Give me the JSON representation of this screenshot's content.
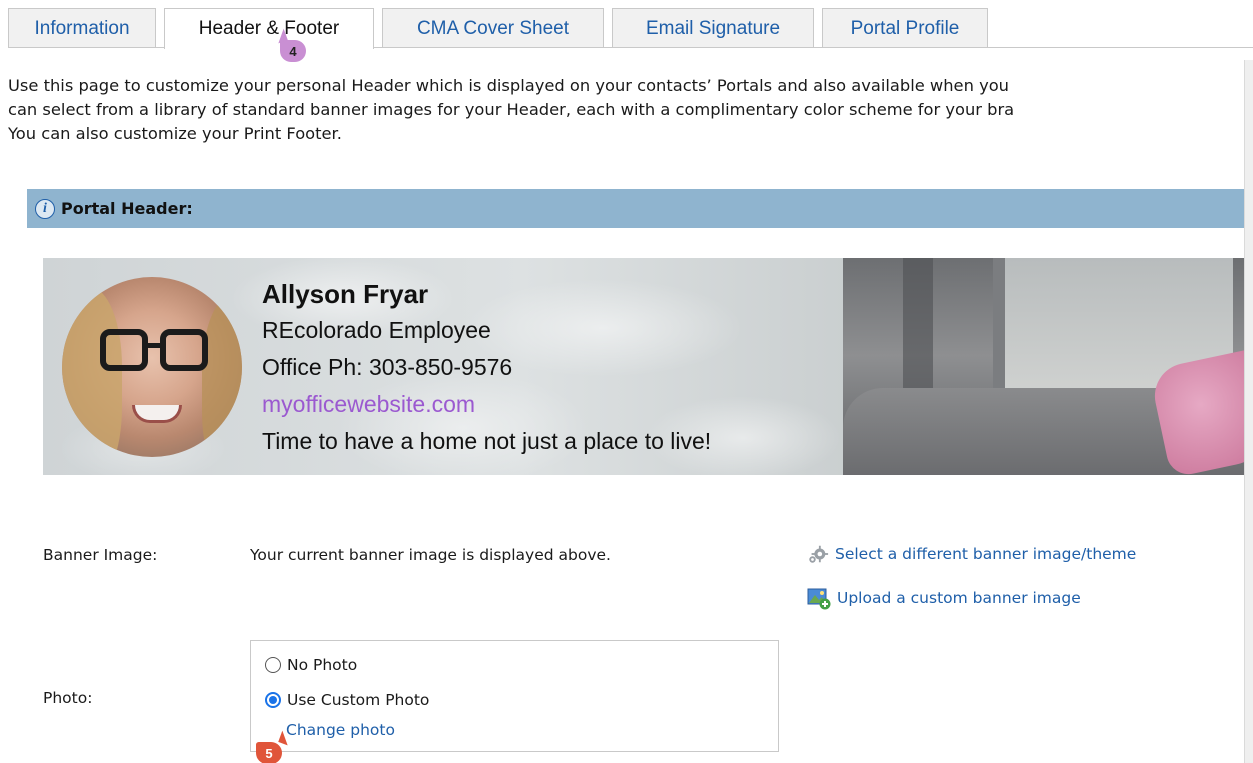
{
  "tabs": [
    {
      "label": "Information",
      "active": false
    },
    {
      "label": "Header & Footer",
      "active": true
    },
    {
      "label": "CMA Cover Sheet",
      "active": false
    },
    {
      "label": "Email Signature",
      "active": false
    },
    {
      "label": "Portal Profile",
      "active": false
    }
  ],
  "step_badges": {
    "tab_step": "4",
    "photo_step": "5"
  },
  "intro": {
    "line1": "Use this page to customize your personal Header which is displayed on your contacts’ Portals and also available when you",
    "line2": "can select from a library of standard banner images for your Header, each with a complimentary color scheme for your bra",
    "line3": "You can also customize your Print Footer."
  },
  "section": {
    "title": "Portal Header:"
  },
  "banner": {
    "name": "Allyson Fryar",
    "title": "REcolorado Employee",
    "phone": "Office Ph: 303-850-9576",
    "website": "myofficewebsite.com",
    "tagline": "Time to have a home not just a place to live!"
  },
  "banner_image": {
    "label": "Banner Image:",
    "description": "Your current banner image is displayed above.",
    "select_link": "Select a different banner image/theme",
    "upload_link": "Upload a custom banner image"
  },
  "photo_options": {
    "label": "Photo:",
    "no_photo": "No Photo",
    "custom_photo": "Use Custom Photo",
    "selected": "custom_photo",
    "change_link": "Change photo"
  },
  "colors": {
    "accent": "#1f5fa9",
    "section_bg": "#8fb4cf",
    "website": "#9b59d0",
    "radio": "#1a73e8"
  }
}
